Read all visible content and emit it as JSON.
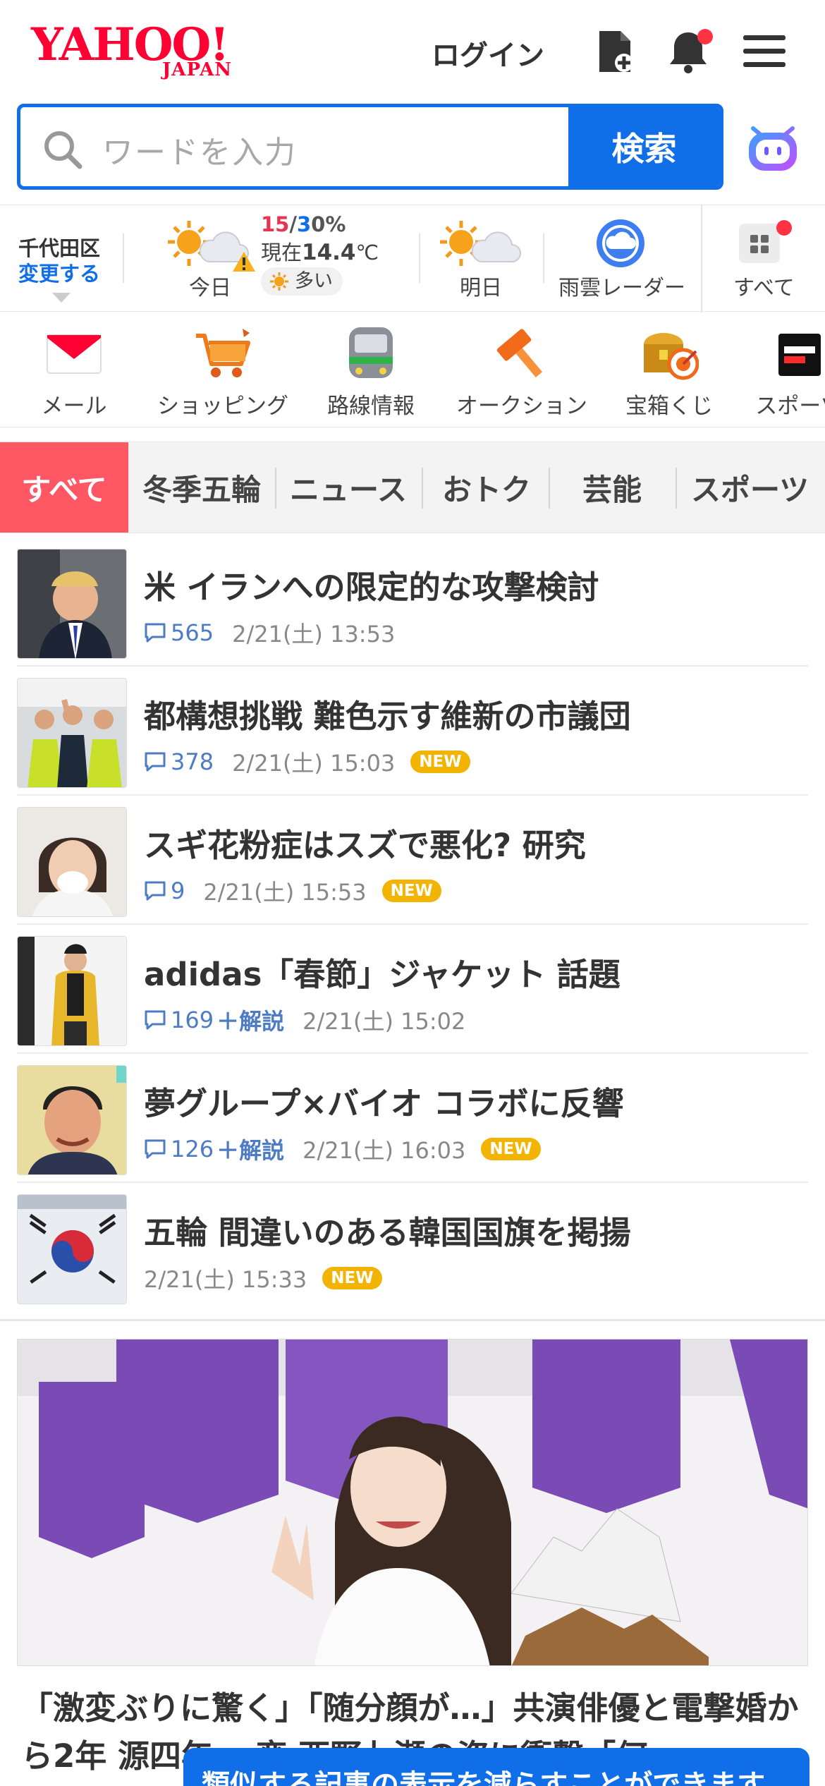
{
  "header": {
    "logo_main": "YAHOO!",
    "logo_sub": "JAPAN",
    "login": "ログイン"
  },
  "search": {
    "placeholder": "ワードを入力",
    "button": "検索"
  },
  "weather": {
    "area": "千代田区",
    "change": "変更する",
    "today_label": "今日",
    "rain_high": "15",
    "rain_sep": "/",
    "rain_low": "3",
    "rain_unit": "0%",
    "now_prefix": "現在",
    "now_temp": "14.4",
    "now_unit": "℃",
    "pollen": "多い",
    "tomorrow_label": "明日",
    "radar_label": "雨雲レーダー",
    "all_label": "すべて"
  },
  "services": [
    {
      "label": "メール",
      "icon": "mail-icon"
    },
    {
      "label": "ショッピング",
      "icon": "cart-icon"
    },
    {
      "label": "路線情報",
      "icon": "train-icon"
    },
    {
      "label": "オークション",
      "icon": "hammer-icon"
    },
    {
      "label": "宝箱くじ",
      "icon": "treasure-icon"
    },
    {
      "label": "スポーツ",
      "icon": "sports-icon"
    }
  ],
  "tabs": [
    "すべて",
    "冬季五輪",
    "ニュース",
    "おトク",
    "芸能",
    "スポーツ"
  ],
  "news": [
    {
      "title": "米 イランへの限定的な攻撃検討",
      "comments": "565",
      "extra": "",
      "time": "2/21(土) 13:53",
      "badge": ""
    },
    {
      "title": "都構想挑戦 難色示す維新の市議団",
      "comments": "378",
      "extra": "",
      "time": "2/21(土) 15:03",
      "badge": "NEW"
    },
    {
      "title": "スギ花粉症はスズで悪化? 研究",
      "comments": "9",
      "extra": "",
      "time": "2/21(土) 15:53",
      "badge": "NEW"
    },
    {
      "title": "adidas「春節」ジャケット 話題",
      "comments": "169",
      "extra": "＋解説",
      "time": "2/21(土) 15:02",
      "badge": ""
    },
    {
      "title": "夢グループ×バイオ コラボに反響",
      "comments": "126",
      "extra": "＋解説",
      "time": "2/21(土) 16:03",
      "badge": "NEW"
    },
    {
      "title": "五輪 間違いのある韓国国旗を掲揚",
      "comments": "",
      "extra": "",
      "time": "2/21(土) 15:33",
      "badge": "NEW"
    }
  ],
  "feature": {
    "title": "「激変ぶりに驚く」「随分顔が…」共演俳優と電撃婚から2年 源四年 一変 西野七瀬の姿に衝撃「何"
  },
  "toast": "類似する記事の表示を減らすことができます",
  "colors": {
    "brand_red": "#ff0033",
    "accent_blue": "#0f6ee8",
    "tab_active": "#ff5864",
    "new_badge": "#f2b400"
  }
}
